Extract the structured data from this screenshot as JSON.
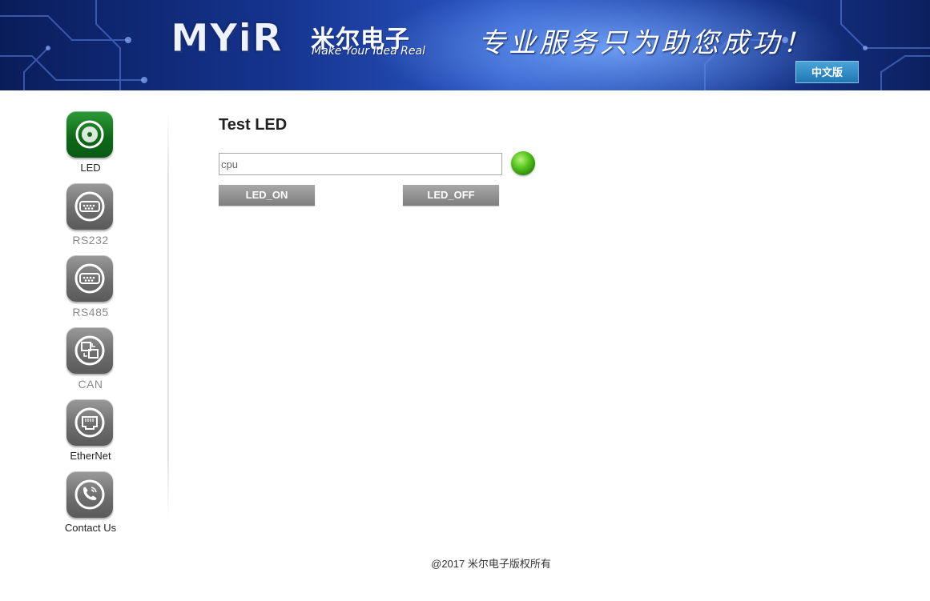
{
  "header": {
    "logo_text": "MYiR",
    "logo_cn": "米尔电子",
    "logo_slogan": "Make Your Idea Real",
    "tagline": "专业服务只为助您成功！",
    "lang_button": "中文版"
  },
  "sidebar": {
    "items": [
      {
        "label": "LED",
        "icon": "led-icon",
        "active": true
      },
      {
        "label": "RS232",
        "icon": "serial-port-icon",
        "active": false
      },
      {
        "label": "RS485",
        "icon": "serial-port-icon",
        "active": false
      },
      {
        "label": "CAN",
        "icon": "can-network-icon",
        "active": false
      },
      {
        "label": "EtherNet",
        "icon": "ethernet-port-icon",
        "active": false
      },
      {
        "label": "Contact Us",
        "icon": "phone-icon",
        "active": false
      }
    ]
  },
  "main": {
    "title": "Test LED",
    "led_input_value": "cpu",
    "led_status_color": "#56c51d",
    "on_button": "LED_ON",
    "off_button": "LED_OFF"
  },
  "footer": {
    "copyright": "@2017 米尔电子版权所有"
  },
  "colors": {
    "banner_blue": "#15348f",
    "active_green": "#0d6b18",
    "button_gray": "#8e8e8e"
  }
}
